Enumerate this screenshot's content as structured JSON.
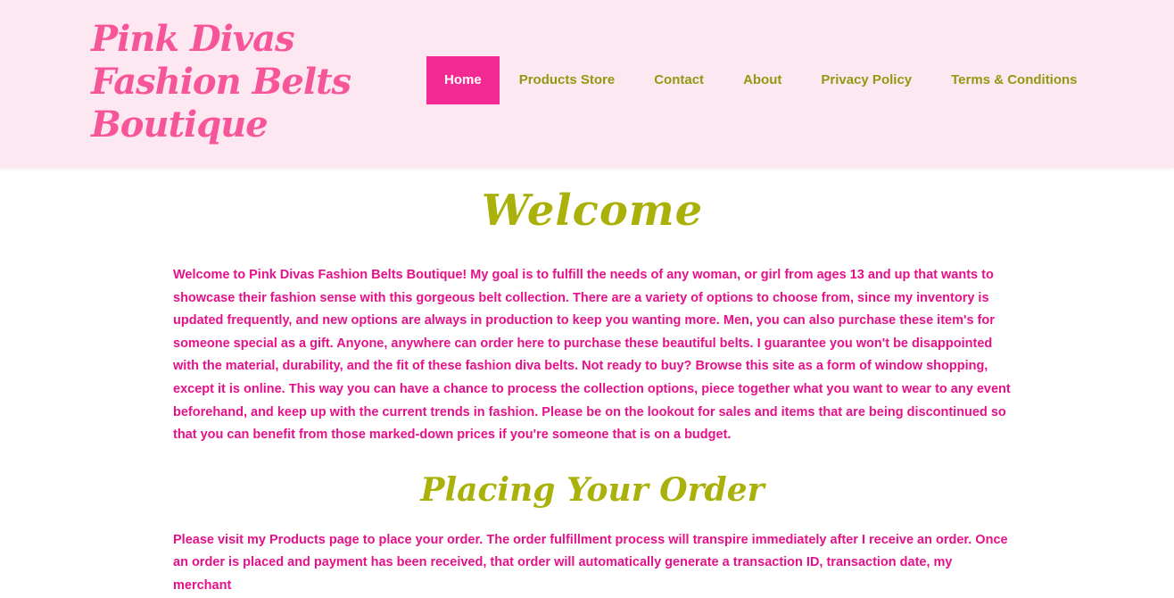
{
  "site": {
    "logo_text": "Pink Divas Fashion Belts Boutique"
  },
  "nav": {
    "items": [
      {
        "label": "Home"
      },
      {
        "label": "Products Store"
      },
      {
        "label": "Contact"
      },
      {
        "label": "About"
      },
      {
        "label": "Privacy Policy"
      },
      {
        "label": "Terms & Conditions"
      }
    ],
    "active": "Home"
  },
  "main": {
    "welcome_heading": "Welcome",
    "welcome_text": "Welcome to Pink Divas Fashion Belts Boutique! My goal is to fulfill the needs of any woman, or girl from ages 13 and up that wants to showcase their fashion sense with this gorgeous belt collection. There are a variety of options to choose from, since my inventory is updated frequently, and new options are always in production to keep you wanting more. Men, you can also purchase these item's for someone special as a gift. Anyone, anywhere can order here to purchase these beautiful belts. I guarantee you won't be disappointed with the material, durability, and the fit of these fashion diva belts. Not ready to buy? Browse this site as a form of  window shopping, except it is online. This way you can have a chance to process the collection options, piece together what you want to wear to any event beforehand, and keep up with the current trends in fashion. Please be on the lookout for sales and items that are being discontinued so that you can benefit from those marked-down prices if you're someone that is on a budget.",
    "order_heading": "Placing Your Order",
    "order_text": "Please visit my Products page to place your order. The order fulfillment process will transpire immediately after I receive an order. Once an order is placed and payment has been received, that order will automatically generate a transaction ID, transaction date, my merchant"
  },
  "colors": {
    "header_bg": "#fde7f0",
    "logo": "#f7559a",
    "nav_text": "#8f9a12",
    "nav_active_bg": "#f42a94",
    "heading": "#aab10a",
    "body_text": "#e5118a"
  }
}
